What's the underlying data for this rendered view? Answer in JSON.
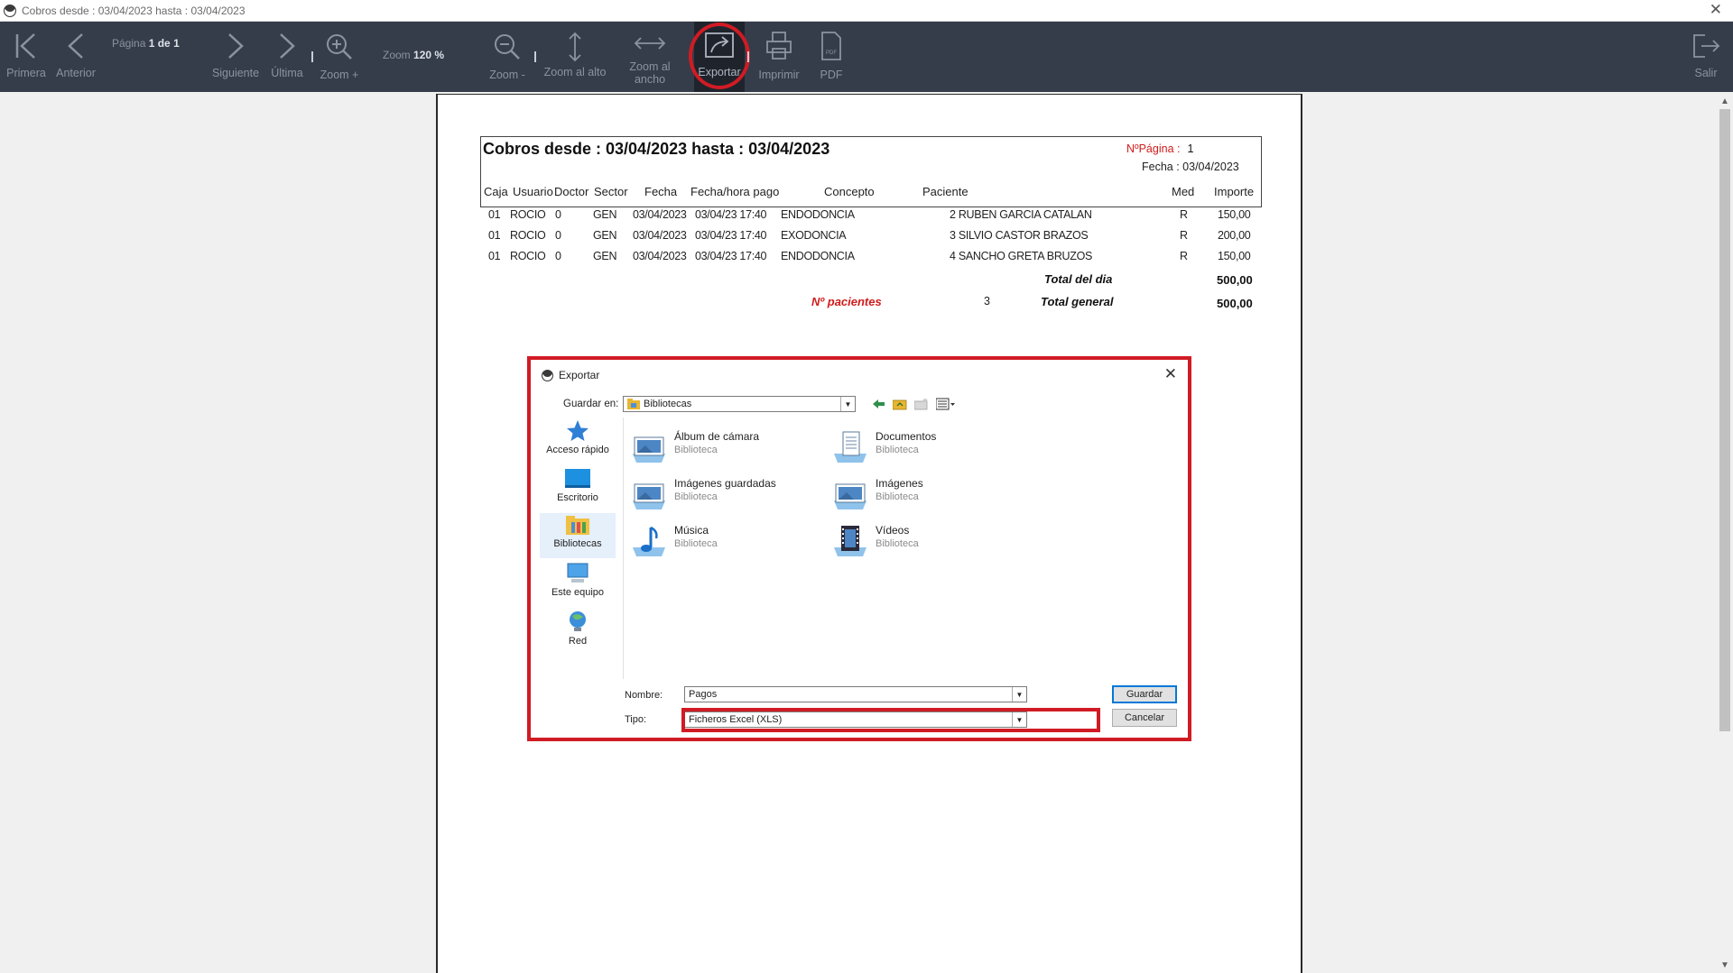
{
  "window": {
    "title": "Cobros desde : 03/04/2023 hasta : 03/04/2023",
    "close_icon": "✕"
  },
  "toolbar": {
    "first": "Primera",
    "previous": "Anterior",
    "page_prefix": "Página",
    "page_value": "1 de 1",
    "next": "Siguiente",
    "last": "Última",
    "zoom_in": "Zoom +",
    "zoom_prefix": "Zoom",
    "zoom_value": "120 %",
    "zoom_out": "Zoom -",
    "zoom_height": "Zoom al alto",
    "zoom_width_1": "Zoom al",
    "zoom_width_2": "ancho",
    "export": "Exportar",
    "print": "Imprimir",
    "pdf": "PDF",
    "pdf_icon_text": "PDF",
    "exit": "Salir"
  },
  "report": {
    "title": "Cobros desde : 03/04/2023 hasta : 03/04/2023",
    "page_label": "NºPágina :",
    "page_number": "1",
    "date_label": "Fecha : 03/04/2023",
    "columns": [
      "Caja",
      "Usuario",
      "Doctor",
      "Sector",
      "Fecha",
      "Fecha/hora pago",
      "Concepto",
      "Paciente",
      "Med",
      "Importe"
    ],
    "rows": [
      {
        "caja": "01",
        "usuario": "ROCIO",
        "doctor": "0",
        "sector": "GEN",
        "fecha": "03/04/2023",
        "pago": "03/04/23 17:40",
        "concepto": "ENDODONCIA",
        "paciente": "2 RUBEN GARCIA CATALAN",
        "med": "R",
        "importe": "150,00"
      },
      {
        "caja": "01",
        "usuario": "ROCIO",
        "doctor": "0",
        "sector": "GEN",
        "fecha": "03/04/2023",
        "pago": "03/04/23 17:40",
        "concepto": "EXODONCIA",
        "paciente": "3 SILVIO CASTOR BRAZOS",
        "med": "R",
        "importe": "200,00"
      },
      {
        "caja": "01",
        "usuario": "ROCIO",
        "doctor": "0",
        "sector": "GEN",
        "fecha": "03/04/2023",
        "pago": "03/04/23 17:40",
        "concepto": "ENDODONCIA",
        "paciente": "4 SANCHO GRETA BRUZOS",
        "med": "R",
        "importe": "150,00"
      }
    ],
    "total_day_label": "Total del dia",
    "total_day_value": "500,00",
    "patients_label": "Nº pacientes",
    "patients_value": "3",
    "total_general_label": "Total general",
    "total_general_value": "500,00"
  },
  "dialog": {
    "title": "Exportar",
    "save_in_label": "Guardar en:",
    "save_in_value": "Bibliotecas",
    "places": [
      {
        "label": "Acceso rápido",
        "icon": "star-icon"
      },
      {
        "label": "Escritorio",
        "icon": "desktop-icon"
      },
      {
        "label": "Bibliotecas",
        "icon": "libraries-icon"
      },
      {
        "label": "Este equipo",
        "icon": "computer-icon"
      },
      {
        "label": "Red",
        "icon": "network-icon"
      }
    ],
    "libraries": [
      {
        "name": "Álbum de cámara",
        "type": "Biblioteca",
        "icon": "pictures-library-icon"
      },
      {
        "name": "Documentos",
        "type": "Biblioteca",
        "icon": "documents-library-icon"
      },
      {
        "name": "Imágenes guardadas",
        "type": "Biblioteca",
        "icon": "pictures-library-icon"
      },
      {
        "name": "Imágenes",
        "type": "Biblioteca",
        "icon": "pictures-library-icon"
      },
      {
        "name": "Música",
        "type": "Biblioteca",
        "icon": "music-library-icon"
      },
      {
        "name": "Vídeos",
        "type": "Biblioteca",
        "icon": "videos-library-icon"
      }
    ],
    "name_label": "Nombre:",
    "name_value": "Pagos",
    "type_label": "Tipo:",
    "type_value": "Ficheros Excel (XLS)",
    "save_button": "Guardar",
    "cancel_button": "Cancelar"
  },
  "colors": {
    "toolbar_bg": "#353d4a",
    "highlight_red": "#d11b24",
    "report_red": "#d01c1c"
  }
}
